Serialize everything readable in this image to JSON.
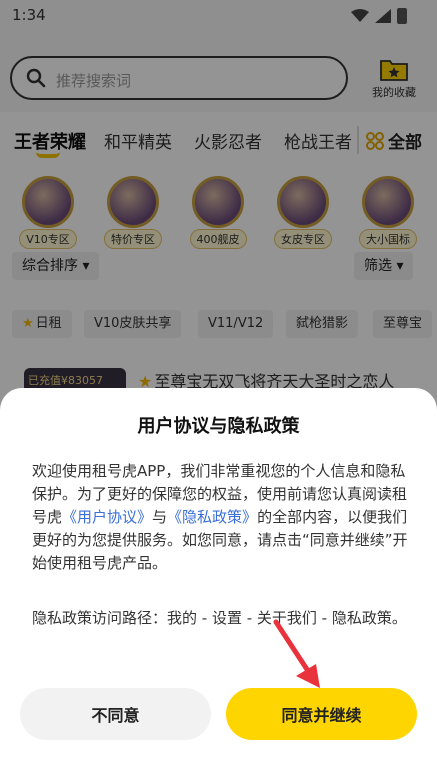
{
  "status_bar": {
    "time": "1:34"
  },
  "search": {
    "placeholder": "推荐搜索词"
  },
  "favorites": {
    "label": "我的收藏"
  },
  "tabs": [
    {
      "label": "王者荣耀",
      "active": true
    },
    {
      "label": "和平精英"
    },
    {
      "label": "火影忍者"
    },
    {
      "label": "枪战王者"
    }
  ],
  "all_tab": {
    "label": "全部"
  },
  "categories": [
    {
      "label": "V10专区"
    },
    {
      "label": "特价专区"
    },
    {
      "label": "400舰皮"
    },
    {
      "label": "女皮专区"
    },
    {
      "label": "大小国标"
    }
  ],
  "sort": {
    "label": "综合排序 ▾",
    "filter_label": "筛选 ▾"
  },
  "chips": [
    "日租",
    "V10皮肤共享",
    "V11/V12",
    "弑枪猎影",
    "至尊宝"
  ],
  "card": {
    "badge": "已充值¥83057",
    "title": "至尊宝无双飞将齐天大圣时之恋人"
  },
  "dialog": {
    "title": "用户协议与隐私政策",
    "body_part1": "欢迎使用租号虎APP，我们非常重视您的个人信息和隐私保护。为了更好的保障您的权益，使用前请您认真阅读租号虎",
    "link_agreement": "《用户协议》",
    "body_and": "与",
    "link_privacy": "《隐私政策》",
    "body_part2": "的全部内容，以便我们更好的为您提供服务。如您同意，请点击“同意并继续”开始使用租号虎产品。",
    "path_text": "隐私政策访问路径：我的 - 设置 - 关于我们 - 隐私政策。",
    "disagree_label": "不同意",
    "agree_label": "同意并继续"
  },
  "colors": {
    "accent": "#ffd500",
    "link": "#3a6fd8",
    "arrow": "#e8323c"
  }
}
